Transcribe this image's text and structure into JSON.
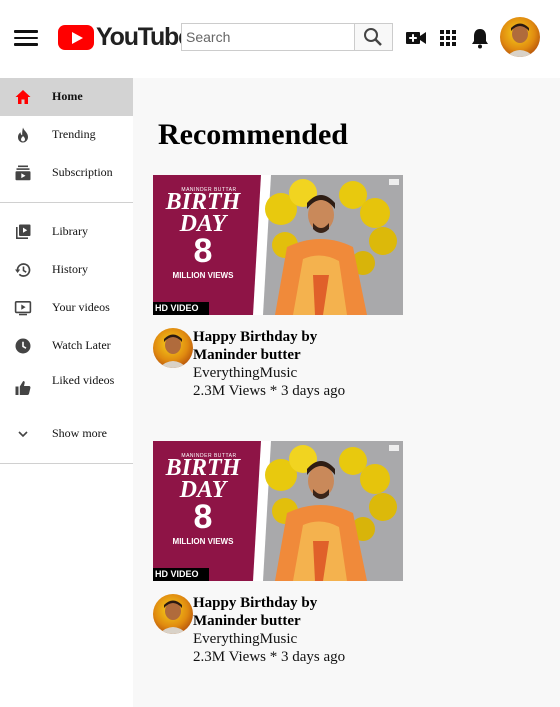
{
  "header": {
    "logo_text": "YouTube",
    "search_placeholder": "Search"
  },
  "sidebar": {
    "items": [
      {
        "label": "Home",
        "icon": "home-icon",
        "active": true
      },
      {
        "label": "Trending",
        "icon": "trending-icon"
      },
      {
        "label": "Subscription",
        "icon": "subscriptions-icon"
      },
      {
        "label": "Library",
        "icon": "library-icon"
      },
      {
        "label": "History",
        "icon": "history-icon"
      },
      {
        "label": "Your videos",
        "icon": "your-videos-icon"
      },
      {
        "label": "Watch Later",
        "icon": "watch-later-icon"
      },
      {
        "label": "Liked videos",
        "icon": "liked-icon"
      },
      {
        "label": "Show more",
        "icon": "chevron-down-icon"
      }
    ]
  },
  "main": {
    "section_title": "Recommended",
    "videos": [
      {
        "title": "Happy Birthday by Maninder butter",
        "channel": "EverythingMusic",
        "meta": "2.3M Views * 3 days ago",
        "thumbnail": {
          "line1": "BIRTH",
          "line2": "DAY",
          "number": "8",
          "views_caption": "MILLION VIEWS",
          "badge": "HD VIDEO"
        }
      },
      {
        "title": "Happy Birthday by Maninder butter",
        "channel": "EverythingMusic",
        "meta": "2.3M Views * 3 days ago",
        "thumbnail": {
          "line1": "BIRTH",
          "line2": "DAY",
          "number": "8",
          "views_caption": "MILLION VIEWS",
          "badge": "HD VIDEO"
        }
      }
    ]
  },
  "colors": {
    "brand_red": "#ff0000",
    "thumb_magenta": "#8e1446",
    "balloon_yellow": "#e8c90e"
  }
}
